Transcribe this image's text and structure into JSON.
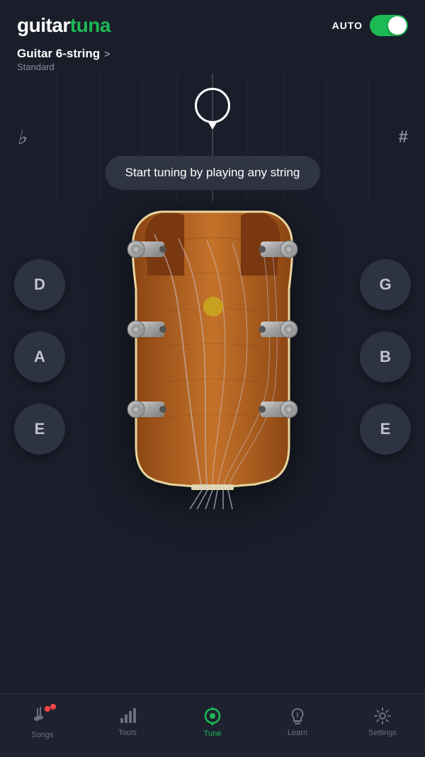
{
  "app": {
    "title": "guitartuna",
    "logo_guitar": "guitar",
    "logo_tuna": "tuna"
  },
  "header": {
    "auto_label": "AUTO",
    "toggle_on": true
  },
  "instrument": {
    "name": "Guitar 6-string",
    "chevron": ">",
    "tuning": "Standard"
  },
  "tuner": {
    "flat_symbol": "♭",
    "sharp_symbol": "#",
    "prompt": "Start tuning by playing any string"
  },
  "strings": {
    "left": [
      "D",
      "A",
      "E"
    ],
    "right": [
      "G",
      "B",
      "E"
    ]
  },
  "nav": {
    "items": [
      {
        "id": "songs",
        "label": "Songs",
        "icon": "♫",
        "active": false,
        "dot": true
      },
      {
        "id": "tools",
        "label": "Tools",
        "icon": "📊",
        "active": false,
        "dot": false
      },
      {
        "id": "tune",
        "label": "Tune",
        "icon": "◎",
        "active": true,
        "dot": false
      },
      {
        "id": "learn",
        "label": "Learn",
        "icon": "𝄞",
        "active": false,
        "dot": false
      },
      {
        "id": "settings",
        "label": "Settings",
        "icon": "⚙",
        "active": false,
        "dot": false
      }
    ]
  },
  "colors": {
    "accent_green": "#1db954",
    "background": "#1a1e2a",
    "nav_bg": "#1e2230",
    "button_bg": "#2e3344",
    "yellow_dot": "#c8a020"
  }
}
